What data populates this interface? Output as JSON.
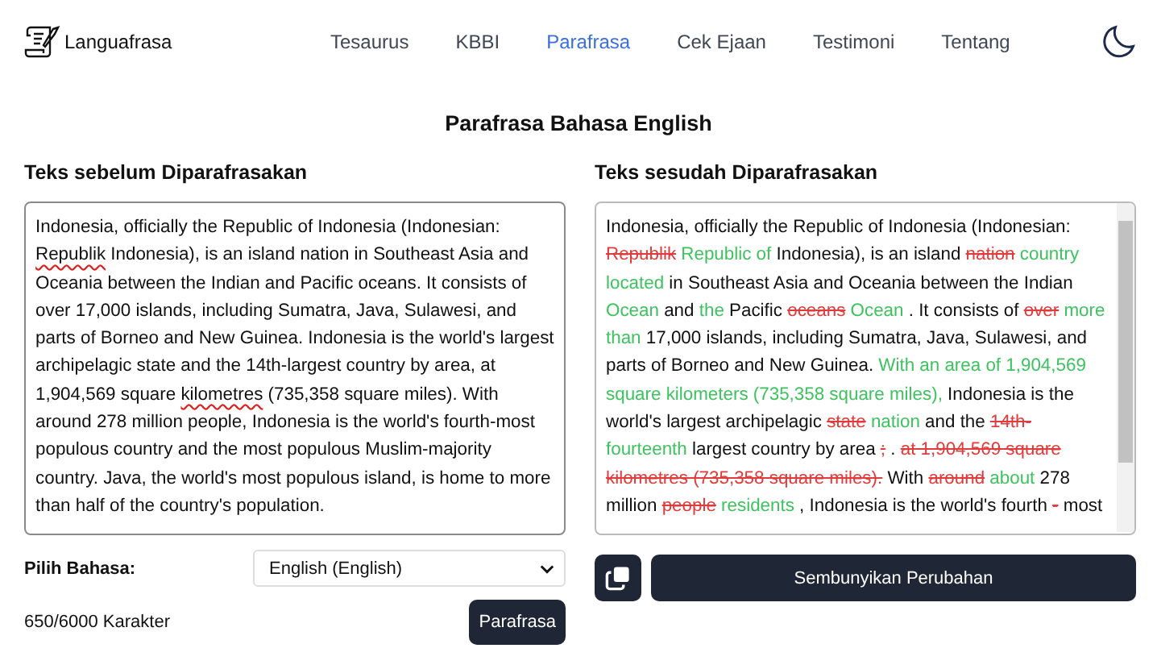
{
  "brand": "Languafrasa",
  "nav": [
    {
      "label": "Tesaurus",
      "selected": false
    },
    {
      "label": "KBBI",
      "selected": false
    },
    {
      "label": "Parafrasa",
      "selected": true
    },
    {
      "label": "Cek Ejaan",
      "selected": false
    },
    {
      "label": "Testimoni",
      "selected": false
    },
    {
      "label": "Tentang",
      "selected": false
    }
  ],
  "title": "Parafrasa Bahasa English",
  "input": {
    "label": "Teks sebelum Diparafrasakan",
    "segments": [
      {
        "text": "Indonesia, officially the Republic of Indonesia (Indonesian: ",
        "misspelled": false
      },
      {
        "text": "Republik",
        "misspelled": true
      },
      {
        "text": " Indonesia), is an island nation in Southeast Asia and Oceania between the Indian and Pacific oceans. It consists of over 17,000 islands, including Sumatra, Java, Sulawesi, and parts of Borneo and New Guinea. Indonesia is the world's largest archipelagic state and the 14th-largest country by area, at 1,904,569 square ",
        "misspelled": false
      },
      {
        "text": "kilometres",
        "misspelled": true
      },
      {
        "text": " (735,358 square miles). With around 278 million people, Indonesia is the world's fourth-most populous country and the most populous Muslim-majority country. Java, the world's most populous island, is home to more than half of the country's population.",
        "misspelled": false
      }
    ]
  },
  "output": {
    "label": "Teks sesudah Diparafrasakan",
    "segments": [
      {
        "text": "Indonesia, officially the Republic of Indonesia (Indonesian: ",
        "kind": "same"
      },
      {
        "text": "Republik",
        "kind": "removed"
      },
      {
        "text": " Republic of",
        "kind": "added"
      },
      {
        "text": " Indonesia), is an island ",
        "kind": "same"
      },
      {
        "text": "nation",
        "kind": "removed"
      },
      {
        "text": " country located",
        "kind": "added"
      },
      {
        "text": " in Southeast Asia and Oceania between the Indian ",
        "kind": "same"
      },
      {
        "text": "Ocean",
        "kind": "added"
      },
      {
        "text": " and ",
        "kind": "same"
      },
      {
        "text": "the",
        "kind": "added"
      },
      {
        "text": " Pacific ",
        "kind": "same"
      },
      {
        "text": "oceans",
        "kind": "removed"
      },
      {
        "text": " Ocean",
        "kind": "added"
      },
      {
        "text": " . It consists of ",
        "kind": "same"
      },
      {
        "text": "over",
        "kind": "removed"
      },
      {
        "text": " more than",
        "kind": "added"
      },
      {
        "text": " 17,000 islands, including Sumatra, Java, Sulawesi, and parts of Borneo and New Guinea. ",
        "kind": "same"
      },
      {
        "text": "With an area of 1,904,569 square kilometers (735,358 square miles),",
        "kind": "added"
      },
      {
        "text": " Indonesia is the world's largest archipelagic ",
        "kind": "same"
      },
      {
        "text": "state",
        "kind": "removed"
      },
      {
        "text": " nation",
        "kind": "added"
      },
      {
        "text": " and the ",
        "kind": "same"
      },
      {
        "text": "14th-",
        "kind": "removed"
      },
      {
        "text": " fourteenth",
        "kind": "added"
      },
      {
        "text": " largest country by area ",
        "kind": "same"
      },
      {
        "text": ";",
        "kind": "removed"
      },
      {
        "text": " . ",
        "kind": "same"
      },
      {
        "text": "at 1,904,569 square kilometres (735,358 square miles).",
        "kind": "removed"
      },
      {
        "text": " With ",
        "kind": "same"
      },
      {
        "text": "around",
        "kind": "removed"
      },
      {
        "text": " about",
        "kind": "added"
      },
      {
        "text": " 278 million ",
        "kind": "same"
      },
      {
        "text": "people",
        "kind": "removed"
      },
      {
        "text": " residents",
        "kind": "added"
      },
      {
        "text": " , Indonesia is the world's fourth ",
        "kind": "same"
      },
      {
        "text": "-",
        "kind": "removed"
      },
      {
        "text": " most",
        "kind": "same"
      }
    ]
  },
  "language": {
    "label": "Pilih Bahasa:",
    "value": "English (English)"
  },
  "counter": "650/6000 Karakter",
  "paraphrase_button": "Parafrasa",
  "toggle_button": "Sembunyikan Perubahan"
}
